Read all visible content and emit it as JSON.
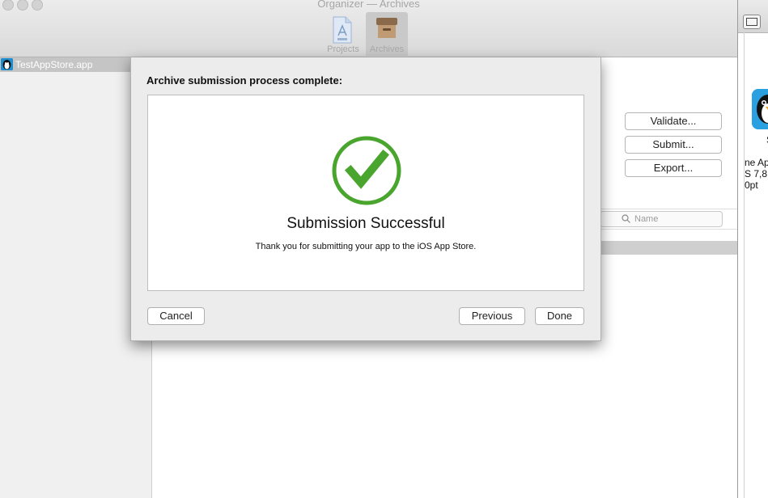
{
  "window": {
    "title": "Organizer — Archives"
  },
  "toolbar": {
    "projects_label": "Projects",
    "archives_label": "Archives"
  },
  "sidebar": {
    "items": [
      {
        "label": "TestAppStore.app"
      }
    ]
  },
  "actions": {
    "validate_label": "Validate...",
    "submit_label": "Submit...",
    "export_label": "Export..."
  },
  "search": {
    "placeholder": "Name"
  },
  "side_window": {
    "caption_char": "S",
    "line1": "ne App",
    "line2": "S 7,8",
    "line3": "0pt"
  },
  "dialog": {
    "heading": "Archive submission process complete:",
    "status_title": "Submission Successful",
    "status_message": "Thank you for submitting your app to the iOS App Store.",
    "cancel_label": "Cancel",
    "previous_label": "Previous",
    "done_label": "Done",
    "check_color": "#4aa52e"
  },
  "icons": {
    "projects": "projects-document-icon",
    "archives": "archives-box-icon",
    "search": "search-icon",
    "success": "checkmark-circle-icon",
    "app": "app-penguin-icon"
  }
}
